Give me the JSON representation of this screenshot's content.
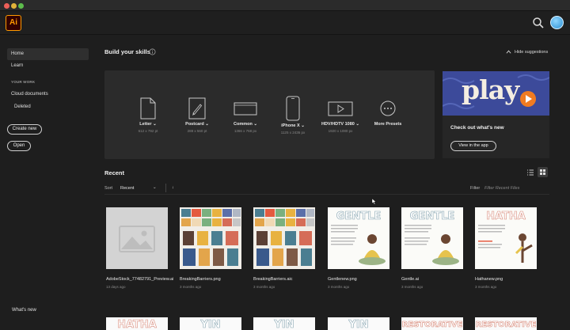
{
  "app": {
    "logo_text": "Ai",
    "accent": "#ff9a00"
  },
  "sidebar": {
    "home": "Home",
    "learn": "Learn",
    "your_work_heading": "YOUR WORK",
    "cloud_documents": "Cloud documents",
    "deleted": "Deleted",
    "create_new": "Create new",
    "open": "Open",
    "whats_new": "What's new"
  },
  "skills": {
    "title": "Build your skills",
    "hide_suggestions": "Hide suggestions"
  },
  "presets": [
    {
      "name": "Letter",
      "dims": "612 x 792 pt",
      "icon": "document-icon"
    },
    {
      "name": "Postcard",
      "dims": "288 x 560 pt",
      "icon": "postcard-brush-icon"
    },
    {
      "name": "Common",
      "dims": "1366 x 768 px",
      "icon": "screen-icon"
    },
    {
      "name": "iPhone X",
      "dims": "1125 x 2436 px",
      "icon": "phone-icon"
    },
    {
      "name": "HDV/HDTV 1080",
      "dims": "1920 x 1080 px",
      "icon": "video-icon"
    },
    {
      "name": "More Presets",
      "dims": "",
      "icon": "more-icon"
    }
  ],
  "promo": {
    "image_word": "play",
    "title": "Check out what's new",
    "button": "View in the app"
  },
  "recent": {
    "title": "Recent",
    "sort_label": "Sort",
    "sort_value": "Recent",
    "filter_label": "Filter",
    "filter_placeholder": "Filter Recent Files"
  },
  "files": [
    {
      "name": "AdobeStock_77482791_Preview.ai",
      "date": "13 days ago"
    },
    {
      "name": "BreakingBarriers.png",
      "date": "3 months ago"
    },
    {
      "name": "BreakingBarriers.aic",
      "date": "3 months ago"
    },
    {
      "name": "Gentlenew.png",
      "date": "3 months ago"
    },
    {
      "name": "Gentle.ai",
      "date": "3 months ago"
    },
    {
      "name": "Hathanew.png",
      "date": "3 months ago"
    }
  ],
  "thumb_text": {
    "gentle": "GENTLE",
    "hatha": "HATHA"
  },
  "second_row_words": [
    "HATHA",
    "YIN",
    "YIN",
    "YIN",
    "RESTORATIVE",
    "RESTORATIVE"
  ]
}
